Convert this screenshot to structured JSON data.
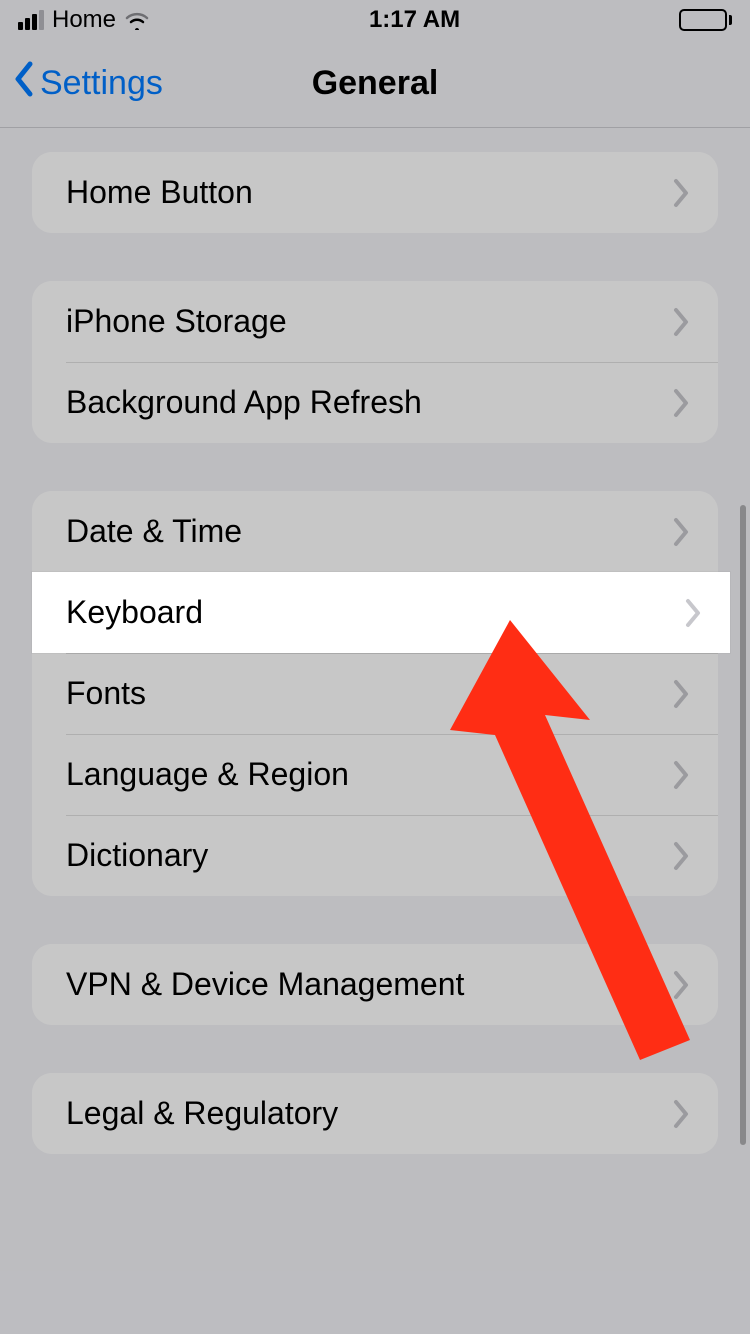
{
  "status": {
    "carrier": "Home",
    "time": "1:17 AM"
  },
  "nav": {
    "back_label": "Settings",
    "title": "General"
  },
  "groups": [
    {
      "rows": [
        {
          "label": "Home Button"
        }
      ]
    },
    {
      "rows": [
        {
          "label": "iPhone Storage"
        },
        {
          "label": "Background App Refresh"
        }
      ]
    },
    {
      "rows": [
        {
          "label": "Date & Time"
        },
        {
          "label": "Keyboard",
          "highlighted": true
        },
        {
          "label": "Fonts"
        },
        {
          "label": "Language & Region"
        },
        {
          "label": "Dictionary"
        }
      ]
    },
    {
      "rows": [
        {
          "label": "VPN & Device Management"
        }
      ]
    },
    {
      "rows": [
        {
          "label": "Legal & Regulatory"
        }
      ]
    }
  ],
  "annotation": {
    "color": "#ff2d14"
  }
}
